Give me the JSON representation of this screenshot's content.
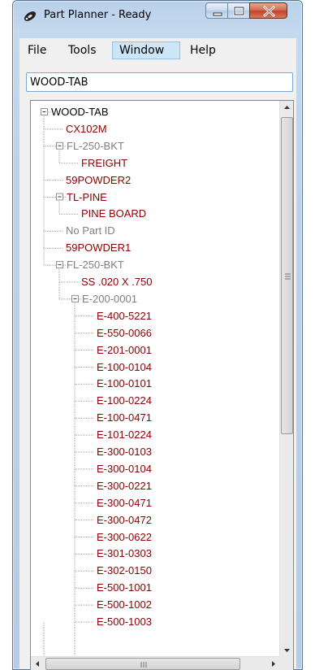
{
  "window": {
    "title": "Part Planner - Ready",
    "icon": "planner-app-icon",
    "controls": [
      "minimize-icon",
      "maximize-icon",
      "close-icon"
    ]
  },
  "menu": {
    "items": [
      {
        "label": "File",
        "active": false
      },
      {
        "label": "Tools",
        "active": false
      },
      {
        "label": "Window",
        "active": true
      },
      {
        "label": "Help",
        "active": false
      }
    ]
  },
  "search": {
    "value": "WOOD-TAB"
  },
  "colors": {
    "part_red": "#8b0000",
    "part_gray": "#808080",
    "root_black": "#000000"
  },
  "tree": {
    "nodes": [
      {
        "label": "WOOD-TAB",
        "depth": 0,
        "expander": "minus",
        "color": "black"
      },
      {
        "label": "CX102M",
        "depth": 1,
        "expander": "none",
        "color": "red"
      },
      {
        "label": "FL-250-BKT",
        "depth": 1,
        "expander": "minus",
        "color": "gray"
      },
      {
        "label": "FREIGHT",
        "depth": 2,
        "expander": "none",
        "color": "red"
      },
      {
        "label": "59POWDER2",
        "depth": 1,
        "expander": "none",
        "color": "red"
      },
      {
        "label": "TL-PINE",
        "depth": 1,
        "expander": "minus",
        "color": "red"
      },
      {
        "label": "PINE BOARD",
        "depth": 2,
        "expander": "none",
        "color": "red"
      },
      {
        "label": "No Part ID",
        "depth": 1,
        "expander": "none",
        "color": "gray"
      },
      {
        "label": "59POWDER1",
        "depth": 1,
        "expander": "none",
        "color": "red"
      },
      {
        "label": "FL-250-BKT",
        "depth": 1,
        "expander": "minus",
        "color": "gray"
      },
      {
        "label": "SS .020 X .750",
        "depth": 2,
        "expander": "none",
        "color": "red"
      },
      {
        "label": "E-200-0001",
        "depth": 2,
        "expander": "minus",
        "color": "gray"
      },
      {
        "label": "E-400-5221",
        "depth": 3,
        "expander": "none",
        "color": "red"
      },
      {
        "label": "E-550-0066",
        "depth": 3,
        "expander": "none",
        "color": "red"
      },
      {
        "label": "E-201-0001",
        "depth": 3,
        "expander": "none",
        "color": "red"
      },
      {
        "label": "E-100-0104",
        "depth": 3,
        "expander": "none",
        "color": "red"
      },
      {
        "label": "E-100-0101",
        "depth": 3,
        "expander": "none",
        "color": "red"
      },
      {
        "label": "E-100-0224",
        "depth": 3,
        "expander": "none",
        "color": "red"
      },
      {
        "label": "E-100-0471",
        "depth": 3,
        "expander": "none",
        "color": "red"
      },
      {
        "label": "E-101-0224",
        "depth": 3,
        "expander": "none",
        "color": "red"
      },
      {
        "label": "E-300-0103",
        "depth": 3,
        "expander": "none",
        "color": "red"
      },
      {
        "label": "E-300-0104",
        "depth": 3,
        "expander": "none",
        "color": "red"
      },
      {
        "label": "E-300-0221",
        "depth": 3,
        "expander": "none",
        "color": "red"
      },
      {
        "label": "E-300-0471",
        "depth": 3,
        "expander": "none",
        "color": "red"
      },
      {
        "label": "E-300-0472",
        "depth": 3,
        "expander": "none",
        "color": "red"
      },
      {
        "label": "E-300-0622",
        "depth": 3,
        "expander": "none",
        "color": "red"
      },
      {
        "label": "E-301-0303",
        "depth": 3,
        "expander": "none",
        "color": "red"
      },
      {
        "label": "E-302-0150",
        "depth": 3,
        "expander": "none",
        "color": "red"
      },
      {
        "label": "E-500-1001",
        "depth": 3,
        "expander": "none",
        "color": "red"
      },
      {
        "label": "E-500-1002",
        "depth": 3,
        "expander": "none",
        "color": "red"
      },
      {
        "label": "E-500-1003",
        "depth": 3,
        "expander": "none",
        "color": "red"
      }
    ]
  },
  "scrollbars": {
    "vertical": {
      "up_icon": "arrow-up-icon",
      "down_icon": "arrow-down-icon",
      "grip_icon": "grip-icon"
    },
    "horizontal": {
      "left_icon": "arrow-left-icon",
      "right_icon": "arrow-right-icon",
      "grip_icon": "grip-icon"
    }
  }
}
